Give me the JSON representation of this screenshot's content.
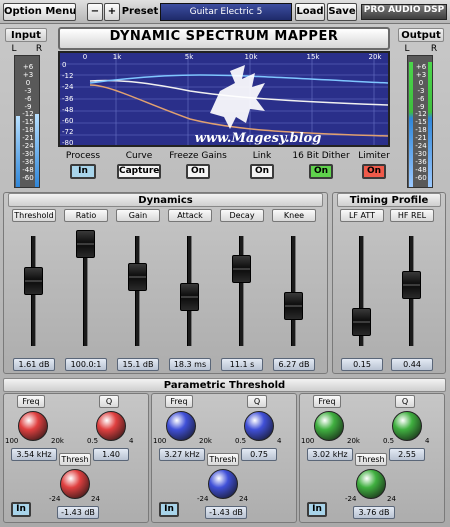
{
  "toolbar": {
    "option_menu": "Option Menu",
    "minus": "−",
    "plus": "+",
    "preset": "Preset",
    "preset_name": "Guitar Electric 5",
    "load": "Load",
    "save": "Save",
    "brand": "PRO AUDIO DSP"
  },
  "io": {
    "input": "Input",
    "output": "Output",
    "l": "L",
    "r": "R",
    "scale": [
      "+6",
      "+3",
      "0",
      "-3",
      "-6",
      "-9",
      "-12",
      "-15",
      "-18",
      "-21",
      "-24",
      "-30",
      "-36",
      "-48",
      "-60"
    ]
  },
  "title": "DYNAMIC SPECTRUM MAPPER",
  "graph": {
    "x_ticks": [
      "0",
      "1k",
      "5k",
      "10k",
      "15k",
      "20k"
    ],
    "y_ticks": [
      "0",
      "-12",
      "-24",
      "-36",
      "-48",
      "-60",
      "-72",
      "-80"
    ],
    "watermark": "www.Magesy.blog"
  },
  "controls": [
    {
      "label": "Process",
      "button": "In",
      "color": "#a8d4ea"
    },
    {
      "label": "Curve",
      "button": "Capture",
      "color": "#f4f4f4"
    },
    {
      "label": "Freeze Gains",
      "button": "On",
      "color": "#f4f4f4"
    },
    {
      "label": "Link",
      "button": "On",
      "color": "#f4f4f4"
    },
    {
      "label": "16 Bit Dither",
      "button": "On",
      "color": "#5fd24c"
    },
    {
      "label": "Limiter",
      "button": "On",
      "color": "#ef5a4a"
    }
  ],
  "dynamics": {
    "title": "Dynamics",
    "sliders": [
      {
        "label": "Threshold",
        "value": "1.61 dB",
        "level": 0.55
      },
      {
        "label": "Ratio",
        "value": "100.0:1",
        "level": 1.0
      },
      {
        "label": "Gain",
        "value": "15.1 dB",
        "level": 0.6
      },
      {
        "label": "Attack",
        "value": "18.3 ms",
        "level": 0.35
      },
      {
        "label": "Decay",
        "value": "11.1 s",
        "level": 0.7
      },
      {
        "label": "Knee",
        "value": "6.27 dB",
        "level": 0.25
      }
    ]
  },
  "timing": {
    "title": "Timing Profile",
    "sliders": [
      {
        "label": "LF ATT",
        "value": "0.15",
        "level": 0.05
      },
      {
        "label": "HF REL",
        "value": "0.44",
        "level": 0.5
      }
    ]
  },
  "parametric": {
    "title": "Parametric Threshold",
    "bands": [
      {
        "freq_label": "Freq",
        "freq_min": "100",
        "freq_max": "20k",
        "freq_value": "3.54 kHz",
        "q_label": "Q",
        "q_min": "0.5",
        "q_max": "4",
        "q_value": "1.40",
        "thresh_label": "Thresh",
        "thresh_min": "-24",
        "thresh_max": "24",
        "thresh_value": "-1.43 dB",
        "in": "In",
        "color": "#e04040"
      },
      {
        "freq_label": "Freq",
        "freq_min": "100",
        "freq_max": "20k",
        "freq_value": "3.27 kHz",
        "q_label": "Q",
        "q_min": "0.5",
        "q_max": "4",
        "q_value": "0.75",
        "thresh_label": "Thresh",
        "thresh_min": "-24",
        "thresh_max": "24",
        "thresh_value": "-1.43 dB",
        "in": "In",
        "color": "#4050d8"
      },
      {
        "freq_label": "Freq",
        "freq_min": "100",
        "freq_max": "20k",
        "freq_value": "3.02 kHz",
        "q_label": "Q",
        "q_min": "0.5",
        "q_max": "4",
        "q_value": "2.55",
        "thresh_label": "Thresh",
        "thresh_min": "-24",
        "thresh_max": "24",
        "thresh_value": "3.76 dB",
        "in": "In",
        "color": "#40b040"
      }
    ]
  },
  "colors": {
    "process_on": "#a8d4ea",
    "dither_on": "#5fd24c",
    "limiter_on": "#ef5a4a",
    "graph_bg": "#2a2f8a"
  }
}
